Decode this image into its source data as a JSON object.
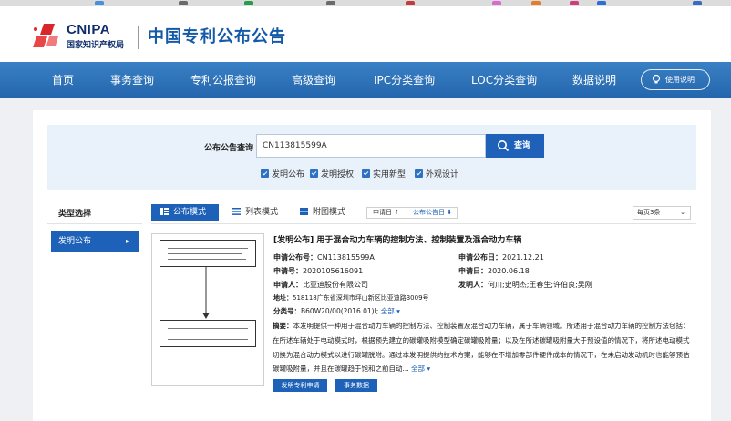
{
  "header": {
    "logo_en": "CNIPA",
    "logo_cn": "国家知识产权局",
    "site_title": "中国专利公布公告"
  },
  "nav": {
    "items": [
      "首页",
      "事务查询",
      "专利公报查询",
      "高级查询",
      "IPC分类查询",
      "LOC分类查询",
      "数据说明"
    ],
    "help_label": "使用说明"
  },
  "search": {
    "label": "公布公告查询",
    "value": "CN113815599A",
    "button_label": "查询",
    "checkboxes": [
      {
        "label": "发明公布",
        "checked": true
      },
      {
        "label": "发明授权",
        "checked": true
      },
      {
        "label": "实用新型",
        "checked": true
      },
      {
        "label": "外观设计",
        "checked": true
      }
    ]
  },
  "sidebar": {
    "header": "类型选择",
    "items": [
      {
        "label": "发明公布",
        "selected": true
      }
    ]
  },
  "toolbar": {
    "modes": [
      "公布模式",
      "列表模式",
      "附图模式"
    ],
    "sort_date": "申请日 ↑",
    "sort_pub": "公布公告日 ⬇",
    "per_page": "每页3条"
  },
  "result": {
    "title": "[发明公布] 用于混合动力车辆的控制方法、控制装置及混合动力车辆",
    "pub_no_label": "申请公布号：",
    "pub_no": "CN113815599A",
    "pub_date_label": "申请公布日：",
    "pub_date": "2021.12.21",
    "app_no_label": "申请号：",
    "app_no": "2020105616091",
    "app_date_label": "申请日：",
    "app_date": "2020.06.18",
    "applicant_label": "申请人：",
    "applicant": "比亚迪股份有限公司",
    "inventor_label": "发明人：",
    "inventor": "何川;史明杰;王春生;许伯良;吴刚",
    "address_label": "地址：",
    "address": "518118广东省深圳市坪山新区比亚迪路3009号",
    "class_label": "分类号：",
    "class_value": "B60W20/00(2016.01)I;",
    "class_more": "全部 ▾",
    "abstract_label": "摘要：",
    "abstract": "本发明提供一种用于混合动力车辆的控制方法、控制装置及混合动力车辆，属于车辆领域。所述用于混合动力车辆的控制方法包括：在所述车辆处于电动模式时，根据预先建立的碳罐吸附模型确定碳罐吸附量；以及在所述碳罐吸附量大于预设值的情况下，将所述电动模式切换为混合动力模式以进行碳罐脱附。通过本发明提供的技术方案，能够在不增加零部件硬件成本的情况下，在未启动发动机时也能够预估碳罐吸附量，并且在碳罐趋于饱和之前自动...",
    "abstract_more": "全部 ▾",
    "btn_register": "发明专利申请",
    "btn_affairs": "事务数据",
    "thumb_box1": "在所述车辆处于电动模式时，根据预先建立的碳罐吸附模型确定碳罐吸附量",
    "thumb_box2": "在所述碳罐吸附量大于预设值的情况下，将所述电动模式切换为混合动力模式以进行碳罐脱附"
  },
  "colors": {
    "nav": "#2a6eb5",
    "accent": "#1d61b8",
    "title": "#155aa8"
  }
}
